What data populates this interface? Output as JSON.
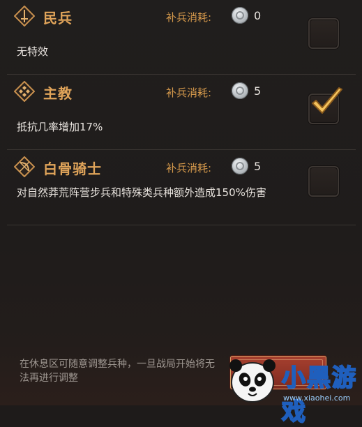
{
  "units": [
    {
      "name": "民兵",
      "cost_label": "补兵消耗:",
      "cost_value": "0",
      "description": "无特效",
      "icon": "sword-emblem-icon",
      "selected": false
    },
    {
      "name": "主教",
      "cost_label": "补兵消耗:",
      "cost_value": "5",
      "description": "抵抗几率增加17%",
      "icon": "cross-emblem-icon",
      "selected": true
    },
    {
      "name": "白骨骑士",
      "cost_label": "补兵消耗:",
      "cost_value": "5",
      "description": "对自然莽荒阵营步兵和特殊类兵种额外造成150%伤害",
      "icon": "bow-emblem-icon",
      "selected": false
    }
  ],
  "footer": {
    "hint": "在休息区可随意调整兵种，一旦战局开始将无法再进行调整"
  },
  "watermark": {
    "title": "小黑游戏",
    "url": "www.xiaohei.com"
  },
  "colors": {
    "accent": "#e0a45a",
    "background": "#1f1c1b",
    "button": "#a6402f"
  }
}
